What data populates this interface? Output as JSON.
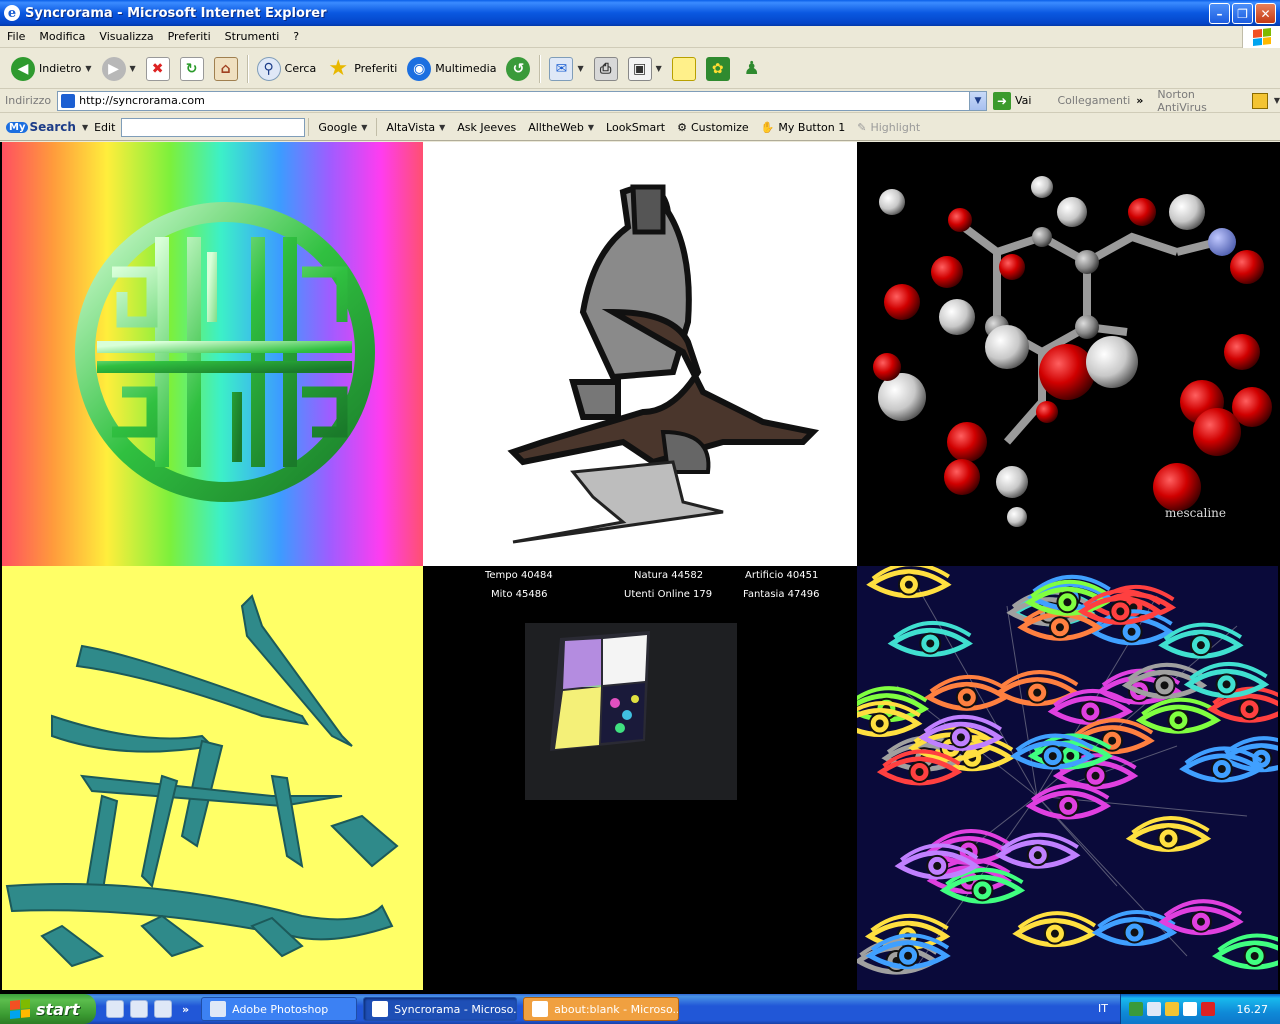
{
  "window": {
    "title": "Syncrorama - Microsoft Internet Explorer"
  },
  "menu": [
    "File",
    "Modifica",
    "Visualizza",
    "Preferiti",
    "Strumenti",
    "?"
  ],
  "toolbar": {
    "back_label": "Indietro",
    "search_label": "Cerca",
    "favorites_label": "Preferiti",
    "media_label": "Multimedia"
  },
  "address": {
    "label": "Indirizzo",
    "url": "http://syncrorama.com",
    "go_label": "Vai",
    "links_label": "Collegamenti",
    "antivirus_label": "Norton AntiVirus"
  },
  "searchbar": {
    "brand": "Search",
    "brand_prefix": "My",
    "edit_label": "Edit",
    "items": [
      "Google",
      "AltaVista",
      "Ask Jeeves",
      "AlltheWeb",
      "LookSmart",
      "Customize",
      "My Button 1",
      "Highlight"
    ]
  },
  "page": {
    "stats": [
      {
        "label": "Tempo 40484"
      },
      {
        "label": "Natura 44582"
      },
      {
        "label": "Artificio 40451"
      },
      {
        "label": "Mito 45486"
      },
      {
        "label": "Utenti Online 179"
      },
      {
        "label": "Fantasia 47496"
      }
    ],
    "molecule_caption": "mescaline",
    "colors": {
      "tile4_bg": "#ffff66",
      "tile5_bg": "#000000",
      "eyes_bg": "#0a0a3a"
    }
  },
  "taskbar": {
    "start_label": "start",
    "tasks": [
      {
        "label": "Adobe Photoshop"
      },
      {
        "label": "Syncrorama - Microso..."
      },
      {
        "label": "about:blank - Microso..."
      }
    ],
    "lang": "IT",
    "clock": "16.27"
  }
}
